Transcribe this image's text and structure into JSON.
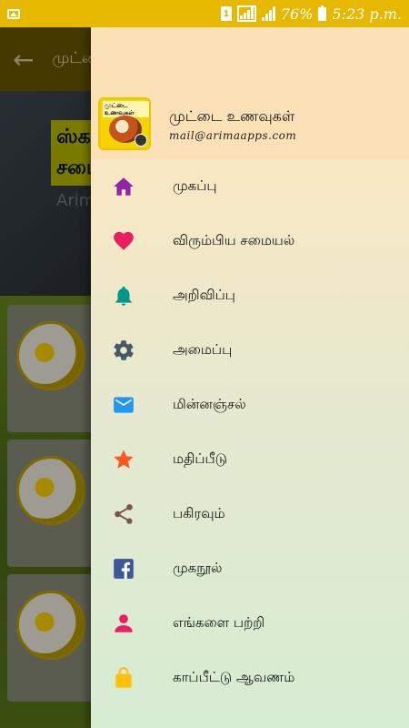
{
  "status_bar": {
    "sim_label": "1",
    "battery_percent": "76%",
    "time": "5:23 p.m."
  },
  "background_app": {
    "title": "முட்டை",
    "hero_text": "ஸ்க சமை",
    "hero_subtext": "Arim"
  },
  "drawer": {
    "app_name": "முட்டை உணவுகள்",
    "email": "mail@arimaapps.com",
    "logo_text": "முட்டை உணவுகள்",
    "items": [
      {
        "label": "முகப்பு",
        "icon": "home-icon",
        "color": "#8e24aa"
      },
      {
        "label": "விரும்பிய சமையல்",
        "icon": "heart-icon",
        "color": "#e91e63"
      },
      {
        "label": "அறிவிப்பு",
        "icon": "bell-icon",
        "color": "#009688"
      },
      {
        "label": "அமைப்பு",
        "icon": "gear-icon",
        "color": "#455a64"
      },
      {
        "label": "மின்னஞ்சல்",
        "icon": "email-icon",
        "color": "#2196f3"
      },
      {
        "label": "மதிப்பீடு",
        "icon": "star-icon",
        "color": "#ff5722"
      },
      {
        "label": "பகிரவும்",
        "icon": "share-icon",
        "color": "#795548"
      },
      {
        "label": "முகநூல்",
        "icon": "facebook-icon",
        "color": "#3b5998"
      },
      {
        "label": "எங்களை பற்றி",
        "icon": "person-icon",
        "color": "#e91e63"
      },
      {
        "label": "காப்பீட்டு ஆவணம்",
        "icon": "lock-icon",
        "color": "#ffc107"
      }
    ]
  }
}
